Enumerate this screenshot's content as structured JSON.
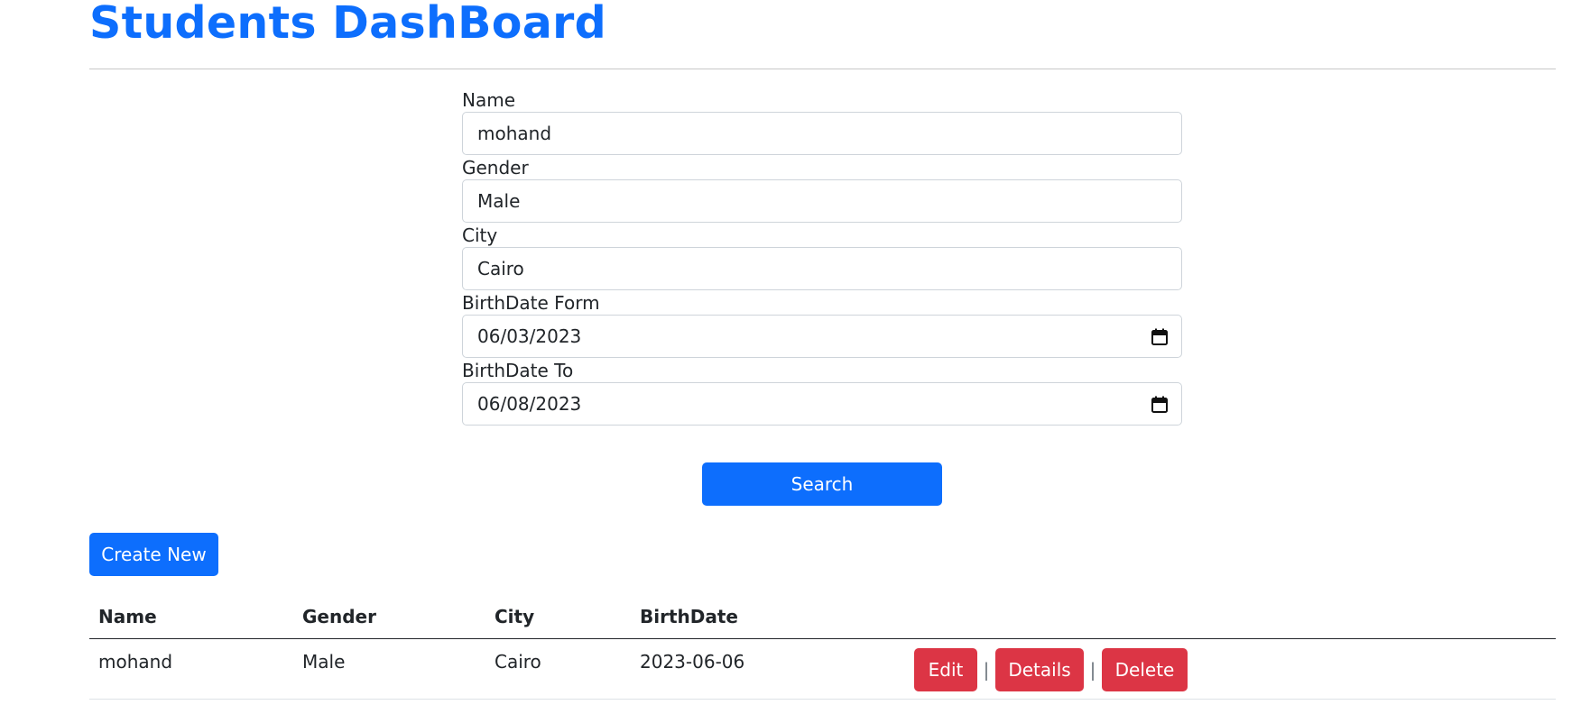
{
  "page": {
    "title": "Students DashBoard"
  },
  "search_form": {
    "fields": [
      {
        "label": "Name",
        "value": "mohand",
        "type": "text"
      },
      {
        "label": "Gender",
        "value": "Male",
        "type": "text"
      },
      {
        "label": "City",
        "value": "Cairo",
        "type": "text"
      },
      {
        "label": "BirthDate Form",
        "value": "06/03/2023",
        "type": "date"
      },
      {
        "label": "BirthDate To",
        "value": "06/08/2023",
        "type": "date"
      }
    ],
    "search_label": "Search"
  },
  "toolbar": {
    "create_label": "Create New"
  },
  "table": {
    "headers": [
      "Name",
      "Gender",
      "City",
      "BirthDate"
    ],
    "rows": [
      {
        "name": "mohand",
        "gender": "Male",
        "city": "Cairo",
        "birthdate": "2023-06-06",
        "actions": {
          "edit": "Edit",
          "details": "Details",
          "delete": "Delete",
          "separator": "|"
        }
      }
    ]
  },
  "colors": {
    "primary": "#0d6efd",
    "danger": "#dc3545",
    "text": "#212529"
  },
  "icons": {
    "date_picker": "calendar-icon"
  }
}
